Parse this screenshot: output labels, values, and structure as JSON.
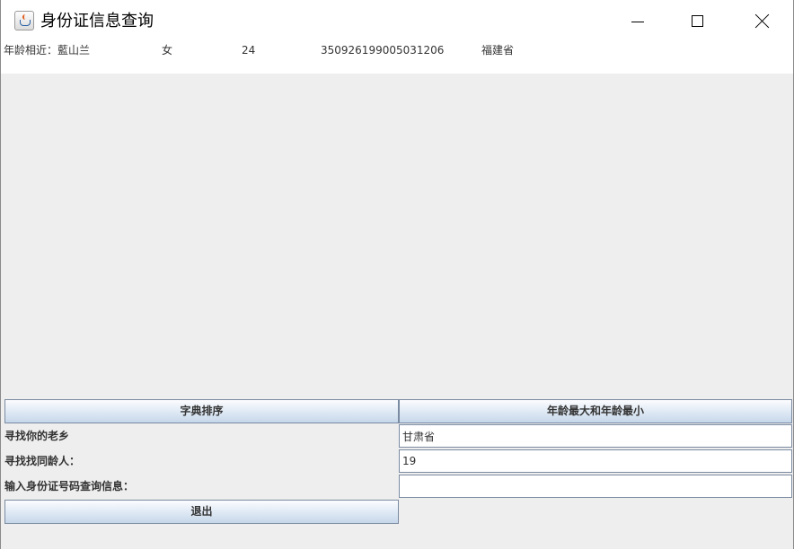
{
  "window": {
    "title": "身份证信息查询"
  },
  "result": {
    "label_prefix": "年龄相近：",
    "name": "藍山兰",
    "gender": "女",
    "age": "24",
    "id_number": "350926199005031206",
    "province": "福建省"
  },
  "buttons": {
    "sort_label": "字典排序",
    "age_range_label": "年龄最大和年龄最小",
    "exit_label": "退出"
  },
  "form": {
    "hometown_label": "寻找你的老乡",
    "hometown_value": "甘肃省",
    "peer_label": "寻找找同龄人：",
    "peer_value": "19",
    "idquery_label": "输入身份证号码查询信息：",
    "idquery_value": ""
  },
  "icons": {
    "app": "java-cup-icon",
    "minimize": "minimize-icon",
    "maximize": "maximize-icon",
    "close": "close-icon"
  }
}
